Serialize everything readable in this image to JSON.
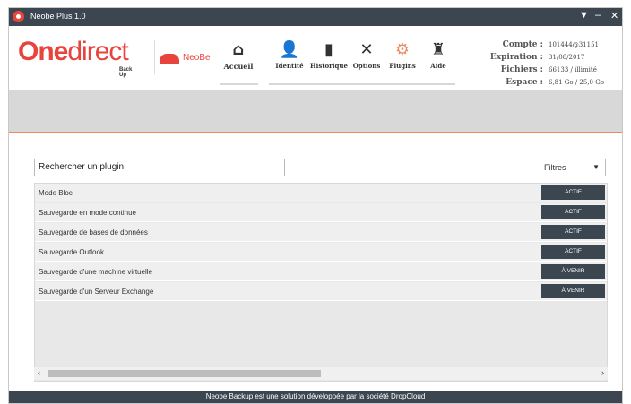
{
  "window": {
    "title": "Neobe Plus 1.0",
    "controls": {
      "menu": "▼",
      "minimize": "–",
      "close": "✕"
    }
  },
  "brand": {
    "one": "One",
    "direct": "direct",
    "sub": "Back Up",
    "neobe": "NeoBe"
  },
  "nav": [
    {
      "label": "Accueil",
      "icon": "home-icon",
      "glyph": "⌂"
    },
    {
      "label": "Identité",
      "icon": "user-icon",
      "glyph": "👤"
    },
    {
      "label": "Historique",
      "icon": "trash-icon",
      "glyph": "▮"
    },
    {
      "label": "Options",
      "icon": "tools-icon",
      "glyph": "✕"
    },
    {
      "label": "Plugins",
      "icon": "gears-icon",
      "glyph": "⚙"
    },
    {
      "label": "Aide",
      "icon": "help-icon",
      "glyph": "♜"
    }
  ],
  "account": {
    "compte_label": "Compte :",
    "compte": "101444@31151",
    "expiration_label": "Expiration :",
    "expiration": "31/08/2017",
    "fichiers_label": "Fichiers :",
    "fichiers": "66133 / illimité",
    "espace_label": "Espace :",
    "espace": "6,81 Go / 25,0 Go"
  },
  "search": {
    "value": "Rechercher un plugin"
  },
  "filters": {
    "value": "Filtres"
  },
  "plugins": [
    {
      "name": "Mode Bloc",
      "status": "ACTIF"
    },
    {
      "name": "Sauvegarde en mode continue",
      "status": "ACTIF"
    },
    {
      "name": "Sauvegarde de bases de données",
      "status": "ACTIF"
    },
    {
      "name": "Sauvegarde Outlook",
      "status": "ACTIF"
    },
    {
      "name": "Sauvegarde d'une machine virtuelle",
      "status": "À VENIR"
    },
    {
      "name": "Sauvegarde d'un Serveur Exchange",
      "status": "À VENIR"
    }
  ],
  "scroll": {
    "left": "‹",
    "right": "›"
  },
  "footer": {
    "text": "Neobe Backup est une solution développée par la société DropCloud"
  },
  "colors": {
    "accent": "#e8433c",
    "dark": "#3c4650",
    "banner": "#d8d8d8",
    "banner_line": "#e98c5f"
  }
}
